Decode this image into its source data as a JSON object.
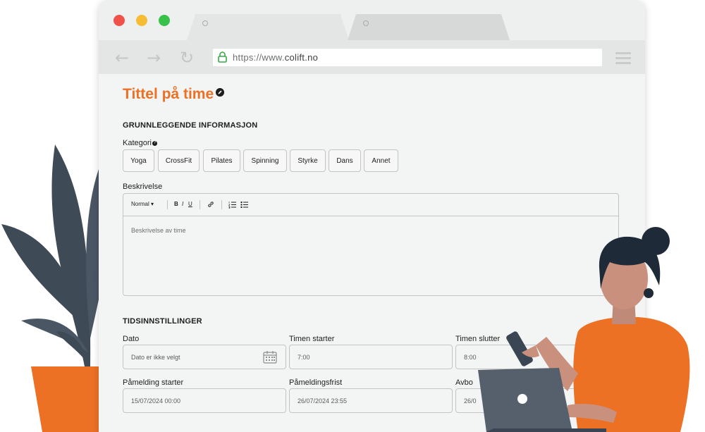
{
  "browser": {
    "url_prefix": "https://www.",
    "url_domain": "www.colift.no",
    "url_host_bold": "colift.no"
  },
  "page": {
    "title": "Tittel på time"
  },
  "basic_info": {
    "heading": "GRUNNLEGGENDE INFORMASJON",
    "category_label": "Kategori",
    "categories": [
      "Yoga",
      "CrossFit",
      "Pilates",
      "Spinning",
      "Styrke",
      "Dans",
      "Annet"
    ],
    "description_label": "Beskrivelse",
    "editor": {
      "format_select": "Normal",
      "bold": "B",
      "italic": "I",
      "underline": "U",
      "placeholder": "Beskrivelse av time"
    }
  },
  "time_settings": {
    "heading": "TIDSINNSTILLINGER",
    "date_label": "Dato",
    "date_value": "Dato er ikke velgt",
    "start_label": "Timen starter",
    "start_value": "7:00",
    "end_label": "Timen slutter",
    "end_value": "8:00",
    "reg_start_label": "Påmelding starter",
    "reg_start_value": "15/07/2024 00:00",
    "reg_deadline_label": "Påmeldingsfrist",
    "reg_deadline_value": "26/07/2024 23:55",
    "cancel_label": "Avbo",
    "cancel_value": "26/0"
  },
  "icons": {
    "back": "arrow-left-icon",
    "forward": "arrow-right-icon",
    "reload": "reload-icon",
    "lock": "lock-icon",
    "menu": "hamburger-menu-icon",
    "calendar": "calendar-icon",
    "link": "link-icon",
    "ordered_list": "ordered-list-icon",
    "bullet_list": "bullet-list-icon",
    "edit": "edit-pencil-icon",
    "help": "help-icon"
  },
  "colors": {
    "accent": "#ec7125",
    "browser_bg": "#f3f4f4",
    "dark": "#1e1e1e"
  }
}
